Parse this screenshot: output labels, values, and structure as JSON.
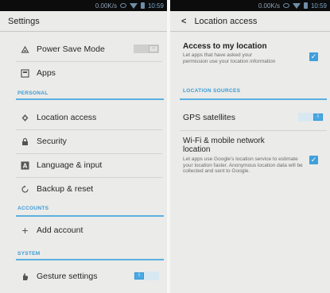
{
  "left": {
    "status": {
      "speed": "0.00K/s",
      "time": "10:59"
    },
    "title": "Settings",
    "items": [
      {
        "label": "Power Save Mode"
      },
      {
        "label": "Apps"
      },
      {
        "label": "Location access"
      },
      {
        "label": "Security"
      },
      {
        "label": "Language & input"
      },
      {
        "label": "Backup & reset"
      },
      {
        "label": "Add account"
      },
      {
        "label": "Gesture settings"
      }
    ],
    "sections": {
      "personal": "PERSONAL",
      "accounts": "ACCOUNTS",
      "system": "SYSTEM"
    },
    "toggles": {
      "power_save": "off",
      "gesture": "on"
    }
  },
  "right": {
    "status": {
      "speed": "0.00K/s",
      "time": "10:59"
    },
    "title": "Location access",
    "access": {
      "title": "Access to my location",
      "description": "Let apps that have asked your permission use your location information",
      "checked": true
    },
    "section": "LOCATION SOURCES",
    "gps": {
      "title": "GPS satellites",
      "toggle": "on"
    },
    "wifi": {
      "title": "Wi-Fi & mobile network location",
      "description": "Let apps use Google's location service to estimate your location faster. Anonymous location data will be collected and sent to Google.",
      "checked": true
    }
  },
  "colors": {
    "accent": "#3a9bd6",
    "status_bar": "#0c0c0c",
    "background": "#ebebe9"
  }
}
